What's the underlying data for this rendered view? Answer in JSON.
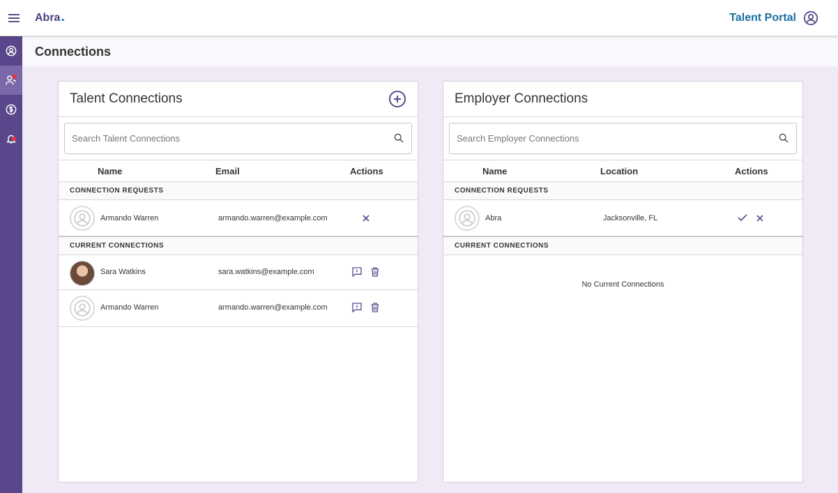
{
  "app": {
    "logo": "Abra",
    "portal_title": "Talent Portal"
  },
  "page": {
    "title": "Connections"
  },
  "talent": {
    "title": "Talent Connections",
    "search_placeholder": "Search Talent Connections",
    "columns": {
      "name": "Name",
      "email": "Email",
      "actions": "Actions"
    },
    "requests_label": "CONNECTION REQUESTS",
    "current_label": "CURRENT CONNECTIONS",
    "requests": [
      {
        "name": "Armando Warren",
        "email": "armando.warren@example.com"
      }
    ],
    "current": [
      {
        "name": "Sara Watkins",
        "email": "sara.watkins@example.com"
      },
      {
        "name": "Armando Warren",
        "email": "armando.warren@example.com"
      }
    ]
  },
  "employer": {
    "title": "Employer Connections",
    "search_placeholder": "Search Employer Connections",
    "columns": {
      "name": "Name",
      "location": "Location",
      "actions": "Actions"
    },
    "requests_label": "CONNECTION REQUESTS",
    "current_label": "CURRENT CONNECTIONS",
    "requests": [
      {
        "name": "Abra",
        "location": "Jacksonville, FL"
      }
    ],
    "empty_message": "No Current Connections"
  }
}
